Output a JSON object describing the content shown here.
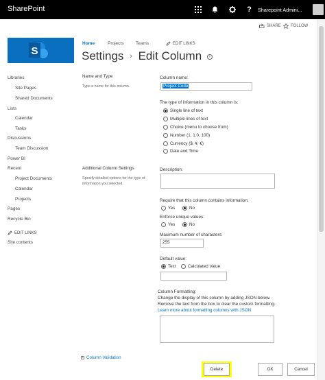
{
  "suite_bar": {
    "brand": "SharePoint",
    "user": "Sharepoint Admini...",
    "icons": [
      "app-launcher-icon",
      "bell-icon",
      "gear-icon",
      "help-icon"
    ]
  },
  "actions": {
    "share": "SHARE",
    "follow": "FOLLOW"
  },
  "global_nav": {
    "home": "Home",
    "projects": "Projects",
    "teams": "Teams",
    "edit_links": "EDIT LINKS"
  },
  "page": {
    "breadcrumb": "Settings",
    "separator": "›",
    "title": "Edit Column"
  },
  "left_nav": {
    "libraries": "Libraries",
    "site_pages": "Site Pages",
    "shared_documents": "Shared Documents",
    "lists": "Lists",
    "calendar": "Calendar",
    "tasks": "Tasks",
    "discussions": "Discussions",
    "team_discussion": "Team Discussion",
    "power_bi": "Power BI",
    "recent": "Recent",
    "project_documents": "Project Documents",
    "recent_calendar": "Calendar",
    "projects": "Projects",
    "pages": "Pages",
    "recycle_bin": "Recycle Bin",
    "edit_links": "EDIT LINKS",
    "site_contents": "Site contents"
  },
  "name_type": {
    "section_title": "Name and Type",
    "section_desc": "Type a name for this column.",
    "column_name_label": "Column name:",
    "column_name_value": "Project Code",
    "type_label": "The type of information in this column is:",
    "types": [
      "Single line of text",
      "Multiple lines of text",
      "Choice (menu to choose from)",
      "Number (1, 1.0, 100)",
      "Currency ($, ¥, €)",
      "Date and Time"
    ],
    "selected_type": "Single line of text"
  },
  "additional": {
    "section_title": "Additional Column Settings",
    "section_desc": "Specify detailed options for the type of information you selected.",
    "description_label": "Description:",
    "description_value": "",
    "require_label": "Require that this column contains information:",
    "enforce_label": "Enforce unique values:",
    "yes": "Yes",
    "no": "No",
    "require_selected": "No",
    "enforce_selected": "No",
    "max_chars_label": "Maximum number of characters:",
    "max_chars_value": "255",
    "default_label": "Default value:",
    "default_text": "Text",
    "default_calc": "Calculated Value",
    "default_selected": "Text",
    "default_value": ""
  },
  "formatting": {
    "title": "Column Formatting:",
    "line1": "Change the display of this column by adding JSON below.",
    "line2": "Remove the text from the box to clear the custom formatting.",
    "link": "Learn more about formatting columns with JSON",
    "json_value": ""
  },
  "validation_link": "Column Validation",
  "buttons": {
    "delete": "Delete",
    "ok": "OK",
    "cancel": "Cancel"
  },
  "colors": {
    "brand_blue": "#0b6fbf",
    "link_blue": "#0072c6",
    "highlight": "#ffff00",
    "suite_bar": "#000000"
  }
}
